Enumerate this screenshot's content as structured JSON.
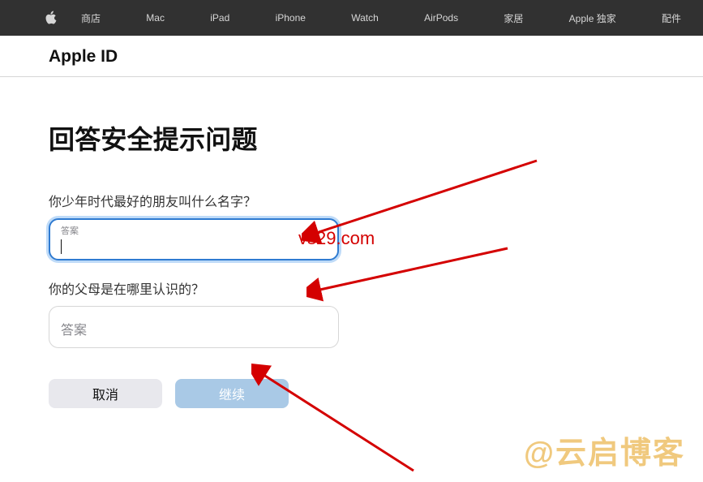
{
  "nav": {
    "items": [
      {
        "label": "商店"
      },
      {
        "label": "Mac"
      },
      {
        "label": "iPad"
      },
      {
        "label": "iPhone"
      },
      {
        "label": "Watch"
      },
      {
        "label": "AirPods"
      },
      {
        "label": "家居"
      },
      {
        "label": "Apple 独家"
      },
      {
        "label": "配件"
      }
    ]
  },
  "subheader": {
    "title": "Apple ID"
  },
  "page": {
    "title": "回答安全提示问题"
  },
  "questions": [
    {
      "text": "你少年时代最好的朋友叫什么名字？",
      "placeholder": "答案",
      "value": ""
    },
    {
      "text": "你的父母是在哪里认识的？",
      "placeholder": "答案",
      "value": ""
    }
  ],
  "buttons": {
    "cancel": "取消",
    "continue": "继续"
  },
  "watermarks": {
    "url": "vs29.com",
    "blog": "@云启博客"
  }
}
